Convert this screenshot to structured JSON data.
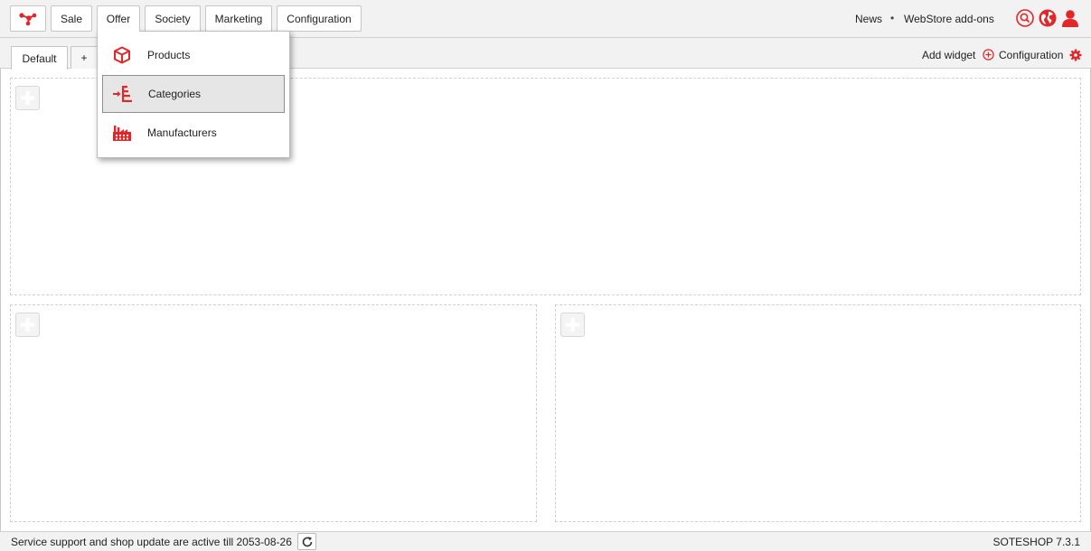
{
  "colors": {
    "accent": "#e3262a",
    "background": "#f2f2f2"
  },
  "logo": {
    "icon": "network-logo-icon"
  },
  "nav": {
    "items": [
      {
        "label": "Sale"
      },
      {
        "label": "Offer",
        "active": true
      },
      {
        "label": "Society"
      },
      {
        "label": "Marketing"
      },
      {
        "label": "Configuration"
      }
    ],
    "right_links": {
      "news": "News",
      "separator": "•",
      "addons": "WebStore add-ons"
    },
    "icons": [
      "search-icon",
      "globe-icon",
      "user-icon"
    ]
  },
  "offer_menu": {
    "items": [
      {
        "label": "Products",
        "icon": "box-icon"
      },
      {
        "label": "Categories",
        "icon": "category-tree-icon",
        "selected": true
      },
      {
        "label": "Manufacturers",
        "icon": "factory-icon"
      }
    ]
  },
  "tabs": {
    "default": "Default",
    "add": "+"
  },
  "toolbar": {
    "add_widget": "Add widget",
    "configuration": "Configuration"
  },
  "footer": {
    "support_text": "Service support and shop update are active till 2053-08-26",
    "version": "SOTESHOP 7.3.1"
  }
}
